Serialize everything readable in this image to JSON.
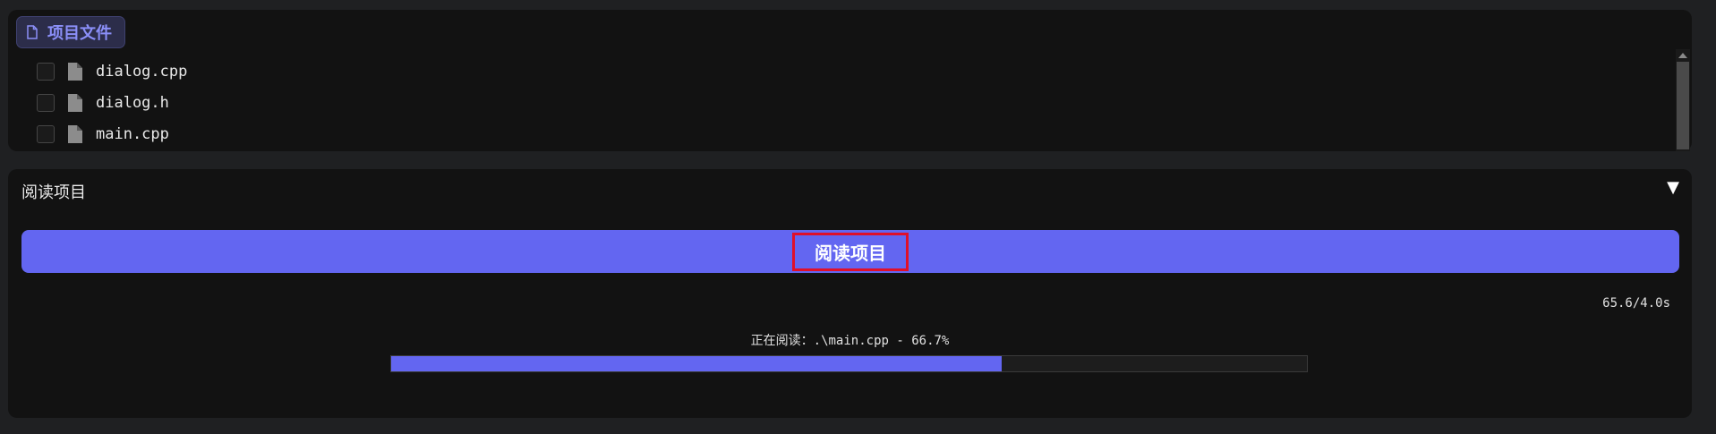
{
  "files_panel": {
    "tab_label": "项目文件",
    "tab_icon": "document-icon",
    "files": [
      {
        "name": "dialog.cpp",
        "checked": false,
        "icon": "file-icon"
      },
      {
        "name": "dialog.h",
        "checked": false,
        "icon": "file-icon"
      },
      {
        "name": "main.cpp",
        "checked": false,
        "icon": "file-icon"
      }
    ]
  },
  "read_panel": {
    "title": "阅读项目",
    "toggle_symbol": "▼",
    "button_label": "阅读项目",
    "timer": "65.6/4.0s",
    "progress_text": "正在阅读：.\\main.cpp - 66.7%",
    "progress": 0.667
  },
  "colors": {
    "accent": "#6366f1",
    "panel": "#121212",
    "background": "#1f2022",
    "highlight_border": "#e0102a"
  }
}
